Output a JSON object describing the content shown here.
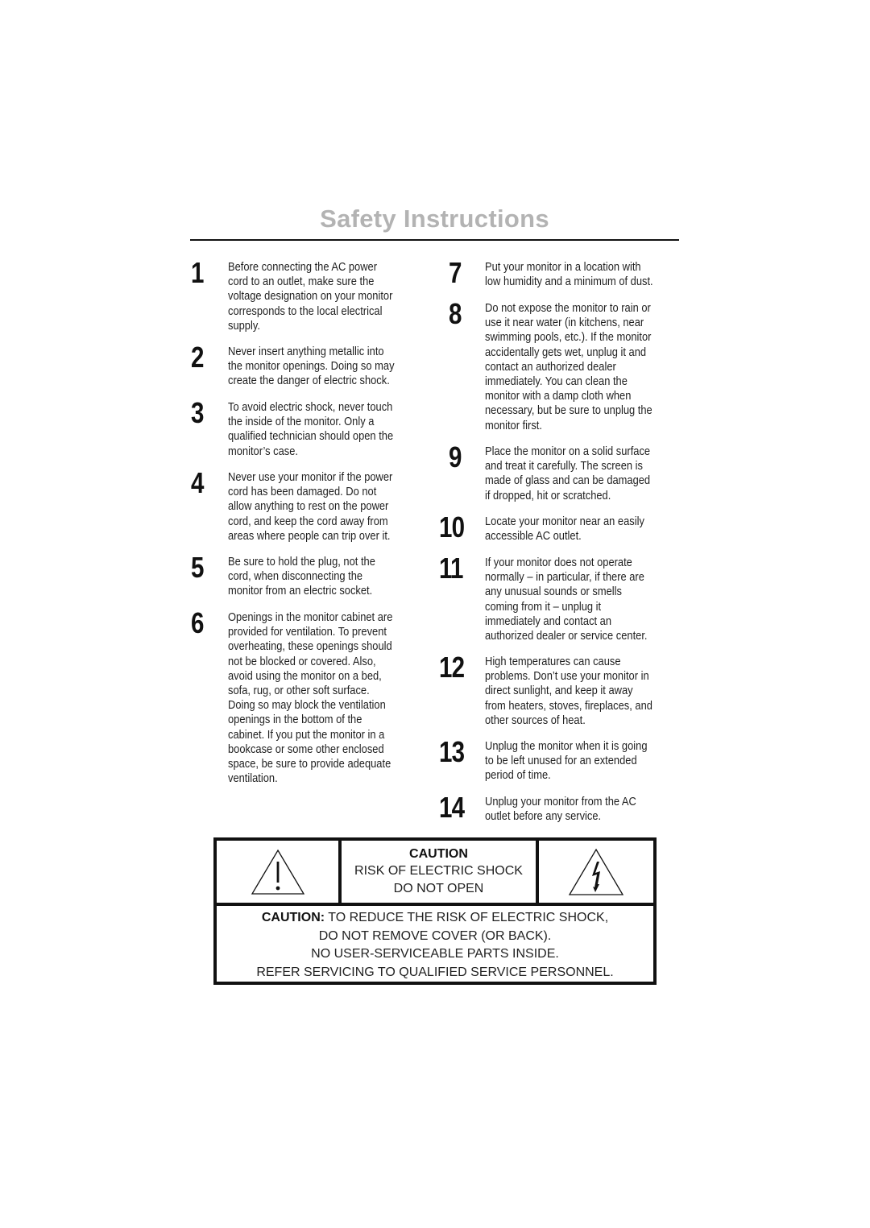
{
  "page": {
    "title": "Safety Instructions"
  },
  "instructions": {
    "left": [
      {
        "number": "1",
        "lines": [
          "Before connecting the AC power",
          "cord to an outlet, make sure the",
          "voltage designation on your monitor",
          "corresponds to the local electrical",
          "supply."
        ]
      },
      {
        "number": "2",
        "lines": [
          "Never insert anything metallic into",
          "the monitor openings. Doing so may",
          "create the danger of electric shock."
        ]
      },
      {
        "number": "3",
        "lines": [
          "To avoid electric shock, never touch",
          "the inside of the monitor. Only a",
          "qualified technician should open the",
          "monitor’s case."
        ]
      },
      {
        "number": "4",
        "lines": [
          "Never use your monitor if the power",
          "cord has been damaged. Do not",
          "allow anything to rest on the power",
          "cord, and keep the cord away from",
          "areas where people can trip over it."
        ]
      },
      {
        "number": "5",
        "lines": [
          "Be sure to hold the plug, not the",
          "cord, when disconnecting the",
          "monitor from an electric socket."
        ]
      },
      {
        "number": "6",
        "lines": [
          "Openings in the monitor cabinet are",
          "provided for ventilation. To prevent",
          "overheating, these openings should",
          "not be blocked or covered. Also,",
          "avoid using the monitor on a bed,",
          "sofa, rug, or other soft surface.",
          "Doing so may block the ventilation",
          "openings in the bottom of the",
          "cabinet. If you put the monitor in a",
          "bookcase or some other enclosed",
          "space, be sure to provide adequate",
          "ventilation."
        ]
      }
    ],
    "right": [
      {
        "number": "7",
        "lines": [
          "Put your monitor in a location with",
          "low humidity and a minimum of dust."
        ]
      },
      {
        "number": "8",
        "lines": [
          "Do not expose the monitor to rain or",
          "use it near water (in kitchens, near",
          "swimming pools, etc.). If the monitor",
          "accidentally gets wet, unplug it and",
          "contact an authorized dealer",
          "immediately. You can clean the",
          "monitor with a damp cloth when",
          "necessary, but be sure to unplug the",
          "monitor first."
        ]
      },
      {
        "number": "9",
        "lines": [
          "Place the monitor on a solid surface",
          "and treat it carefully. The screen is",
          "made of glass and can be damaged",
          "if dropped, hit or scratched."
        ]
      },
      {
        "number": "10",
        "lines": [
          "Locate your monitor near an easily",
          "accessible AC outlet."
        ]
      },
      {
        "number": "11",
        "lines": [
          "If your monitor does not operate",
          "normally – in particular, if there are",
          "any unusual sounds or smells",
          "coming from it – unplug it",
          "immediately and contact an",
          "authorized dealer or service center."
        ]
      },
      {
        "number": "12",
        "lines": [
          "High temperatures can cause",
          "problems. Don’t use your monitor in",
          "direct sunlight, and keep it away",
          "from heaters, stoves, fireplaces, and",
          "other sources of heat."
        ]
      },
      {
        "number": "13",
        "lines": [
          "Unplug the monitor when it is going",
          "to be left unused for an extended",
          "period of time."
        ]
      },
      {
        "number": "14",
        "lines": [
          "Unplug your monitor from the AC",
          "outlet before any service."
        ]
      }
    ]
  },
  "caution": {
    "left_icon": "exclamation-warning-triangle-icon",
    "right_icon": "lightning-bolt-warning-triangle-icon",
    "heading": "CAUTION",
    "line1": "RISK OF ELECTRIC SHOCK",
    "line2": "DO NOT OPEN",
    "notice_label": "CAUTION:",
    "notice_line1": " TO REDUCE THE RISK OF ELECTRIC SHOCK,",
    "notice_line2": "DO NOT REMOVE COVER (OR BACK).",
    "notice_line3": "NO USER-SERVICEABLE PARTS INSIDE.",
    "notice_line4": "REFER SERVICING TO QUALIFIED SERVICE PERSONNEL."
  }
}
